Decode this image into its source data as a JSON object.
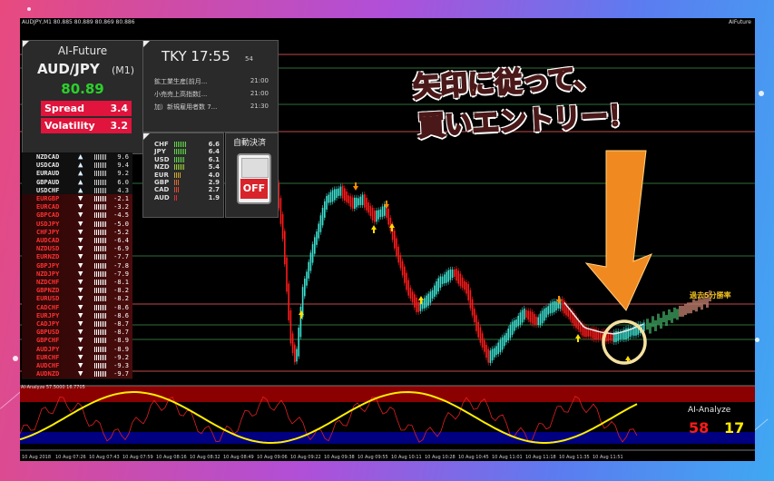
{
  "window": {
    "title": "AUDJPY,M1  80.885 80.889 80.869 80.886",
    "title_right": "AIFuture"
  },
  "ea_panel": {
    "name": "AI-Future",
    "pair": "AUD/JPY",
    "timeframe": "(M1)",
    "price": "80.89",
    "spread_label": "Spread",
    "spread_value": "3.4",
    "volatility_label": "Volatility",
    "volatility_value": "3.2"
  },
  "strength_list": [
    {
      "sym": "NZDCAD",
      "dir": "up",
      "value": "9.6"
    },
    {
      "sym": "USDCAD",
      "dir": "up",
      "value": "9.4"
    },
    {
      "sym": "EURAUD",
      "dir": "up",
      "value": "9.2"
    },
    {
      "sym": "GBPAUD",
      "dir": "up",
      "value": "6.0"
    },
    {
      "sym": "USDCHF",
      "dir": "up",
      "value": "4.3"
    },
    {
      "sym": "EURGBP",
      "dir": "down",
      "value": "-2.1"
    },
    {
      "sym": "EURCAD",
      "dir": "down",
      "value": "-3.2"
    },
    {
      "sym": "GBPCAD",
      "dir": "down",
      "value": "-4.5"
    },
    {
      "sym": "USDJPY",
      "dir": "down",
      "value": "-5.0"
    },
    {
      "sym": "CHFJPY",
      "dir": "down",
      "value": "-5.2"
    },
    {
      "sym": "AUDCAD",
      "dir": "down",
      "value": "-6.4"
    },
    {
      "sym": "NZDUSD",
      "dir": "down",
      "value": "-6.9"
    },
    {
      "sym": "EURNZD",
      "dir": "down",
      "value": "-7.7"
    },
    {
      "sym": "GBPJPY",
      "dir": "down",
      "value": "-7.8"
    },
    {
      "sym": "NZDJPY",
      "dir": "down",
      "value": "-7.9"
    },
    {
      "sym": "NZDCHF",
      "dir": "down",
      "value": "-8.1"
    },
    {
      "sym": "GBPNZD",
      "dir": "down",
      "value": "-8.2"
    },
    {
      "sym": "EURUSD",
      "dir": "down",
      "value": "-8.2"
    },
    {
      "sym": "CADCHF",
      "dir": "down",
      "value": "-8.6"
    },
    {
      "sym": "EURJPY",
      "dir": "down",
      "value": "-8.6"
    },
    {
      "sym": "CADJPY",
      "dir": "down",
      "value": "-8.7"
    },
    {
      "sym": "GBPUSD",
      "dir": "down",
      "value": "-8.7"
    },
    {
      "sym": "GBPCHF",
      "dir": "down",
      "value": "-8.9"
    },
    {
      "sym": "AUDJPY",
      "dir": "down",
      "value": "-8.9"
    },
    {
      "sym": "EURCHF",
      "dir": "down",
      "value": "-9.2"
    },
    {
      "sym": "AUDCHF",
      "dir": "down",
      "value": "-9.3"
    },
    {
      "sym": "AUDNZD",
      "dir": "down",
      "value": "-9.7"
    }
  ],
  "tky_panel": {
    "label": "TKY 17:55",
    "seconds": "54",
    "events": [
      {
        "name": "鉱工業生産[前月...",
        "time": "21:00",
        "color": "#e0303a"
      },
      {
        "name": "小売売上高指数[...",
        "time": "21:00",
        "color": "#cccccc"
      },
      {
        "name": "加）新規雇用者数 7...",
        "time": "21:30",
        "color": "#cccccc"
      }
    ]
  },
  "currency_strength": [
    {
      "ccy": "CHF",
      "value": "6.6",
      "level": 0.66,
      "color": "#5fcf4a"
    },
    {
      "ccy": "JPY",
      "value": "6.4",
      "level": 0.64,
      "color": "#5fcf4a"
    },
    {
      "ccy": "USD",
      "value": "6.1",
      "level": 0.61,
      "color": "#5fcf4a"
    },
    {
      "ccy": "NZD",
      "value": "5.4",
      "level": 0.54,
      "color": "#9acb3a"
    },
    {
      "ccy": "EUR",
      "value": "4.0",
      "level": 0.4,
      "color": "#cfa52e"
    },
    {
      "ccy": "GBP",
      "value": "2.9",
      "level": 0.29,
      "color": "#d86a30"
    },
    {
      "ccy": "CAD",
      "value": "2.7",
      "level": 0.27,
      "color": "#d84a30"
    },
    {
      "ccy": "AUD",
      "value": "1.9",
      "level": 0.19,
      "color": "#d83030"
    }
  ],
  "auto_settle": {
    "label": "自動決済",
    "state": "OFF"
  },
  "forecast_label": "過去5分勝率",
  "captions": {
    "line1": "矢印に従って、",
    "line2": "買いエントリー！"
  },
  "subwindow": {
    "title": "AI-Analyze 57.5000 16.7705",
    "brand": "AI-Analyze",
    "value_red": "58",
    "value_yellow": "17"
  },
  "time_axis": [
    "10 Aug 2018",
    "10 Aug 07:26",
    "10 Aug 07:43",
    "10 Aug 07:59",
    "10 Aug 08:16",
    "10 Aug 08:32",
    "10 Aug 08:49",
    "10 Aug 09:06",
    "10 Aug 09:22",
    "10 Aug 09:38",
    "10 Aug 09:55",
    "10 Aug 10:11",
    "10 Aug 10:28",
    "10 Aug 10:45",
    "10 Aug 11:01",
    "10 Aug 11:18",
    "10 Aug 11:35",
    "10 Aug 11:51"
  ],
  "colors": {
    "bull": "#3de0d0",
    "bear": "#ff1a1a",
    "signal_arrow": "#ffe000",
    "sell_arrow": "#ff8a00",
    "big_arrow": "#f08a20",
    "ring": "#f5e1a0"
  }
}
